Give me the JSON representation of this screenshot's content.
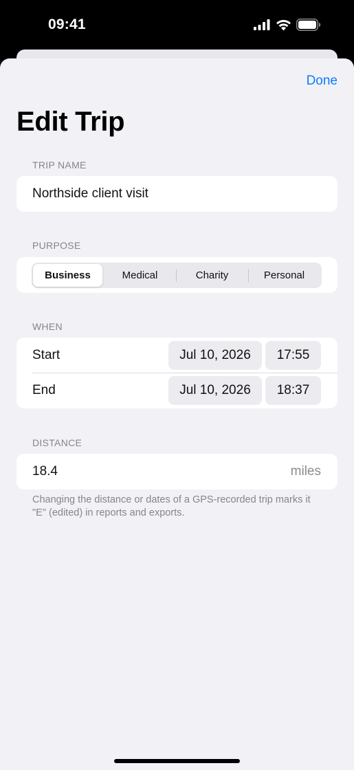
{
  "status": {
    "time": "09:41"
  },
  "toolbar": {
    "done_label": "Done"
  },
  "title": "Edit Trip",
  "trip_name": {
    "header": "TRIP NAME",
    "value": "Northside client visit"
  },
  "purpose": {
    "header": "PURPOSE",
    "options": [
      "Business",
      "Medical",
      "Charity",
      "Personal"
    ],
    "selected": "Business"
  },
  "when": {
    "header": "WHEN",
    "start": {
      "label": "Start",
      "date": "Jul 10, 2026",
      "time": "17:55"
    },
    "end": {
      "label": "End",
      "date": "Jul 10, 2026",
      "time": "18:37"
    }
  },
  "distance": {
    "header": "DISTANCE",
    "value": "18.4",
    "unit": "miles",
    "footnote": "Changing the distance or dates of a GPS-recorded trip marks it \"E\" (edited) in reports and exports."
  },
  "colors": {
    "accent": "#0a7cff",
    "background": "#f1f1f6",
    "card": "#ffffff",
    "secondary_text": "#85858a"
  }
}
